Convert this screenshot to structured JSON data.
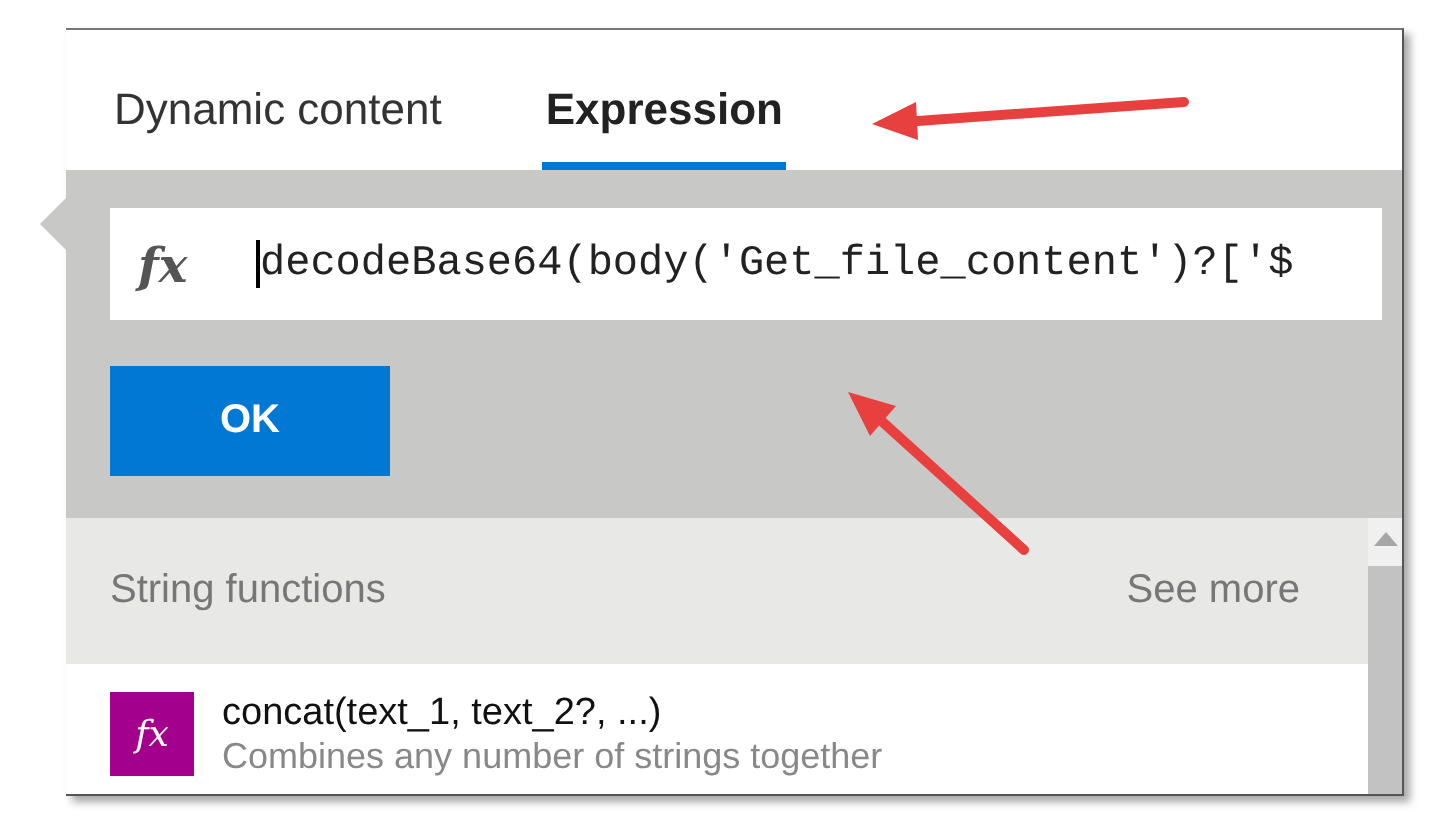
{
  "tabs": [
    {
      "label": "Dynamic content",
      "selected": false
    },
    {
      "label": "Expression",
      "selected": true
    }
  ],
  "expression": {
    "icon": "fx",
    "value": "decodeBase64(body('Get_file_content')?['$"
  },
  "ok_button": "OK",
  "section": {
    "title": "String functions",
    "link": "See more"
  },
  "functions": [
    {
      "icon": "fx",
      "signature": "concat(text_1, text_2?, ...)",
      "description": "Combines any number of strings together"
    }
  ]
}
